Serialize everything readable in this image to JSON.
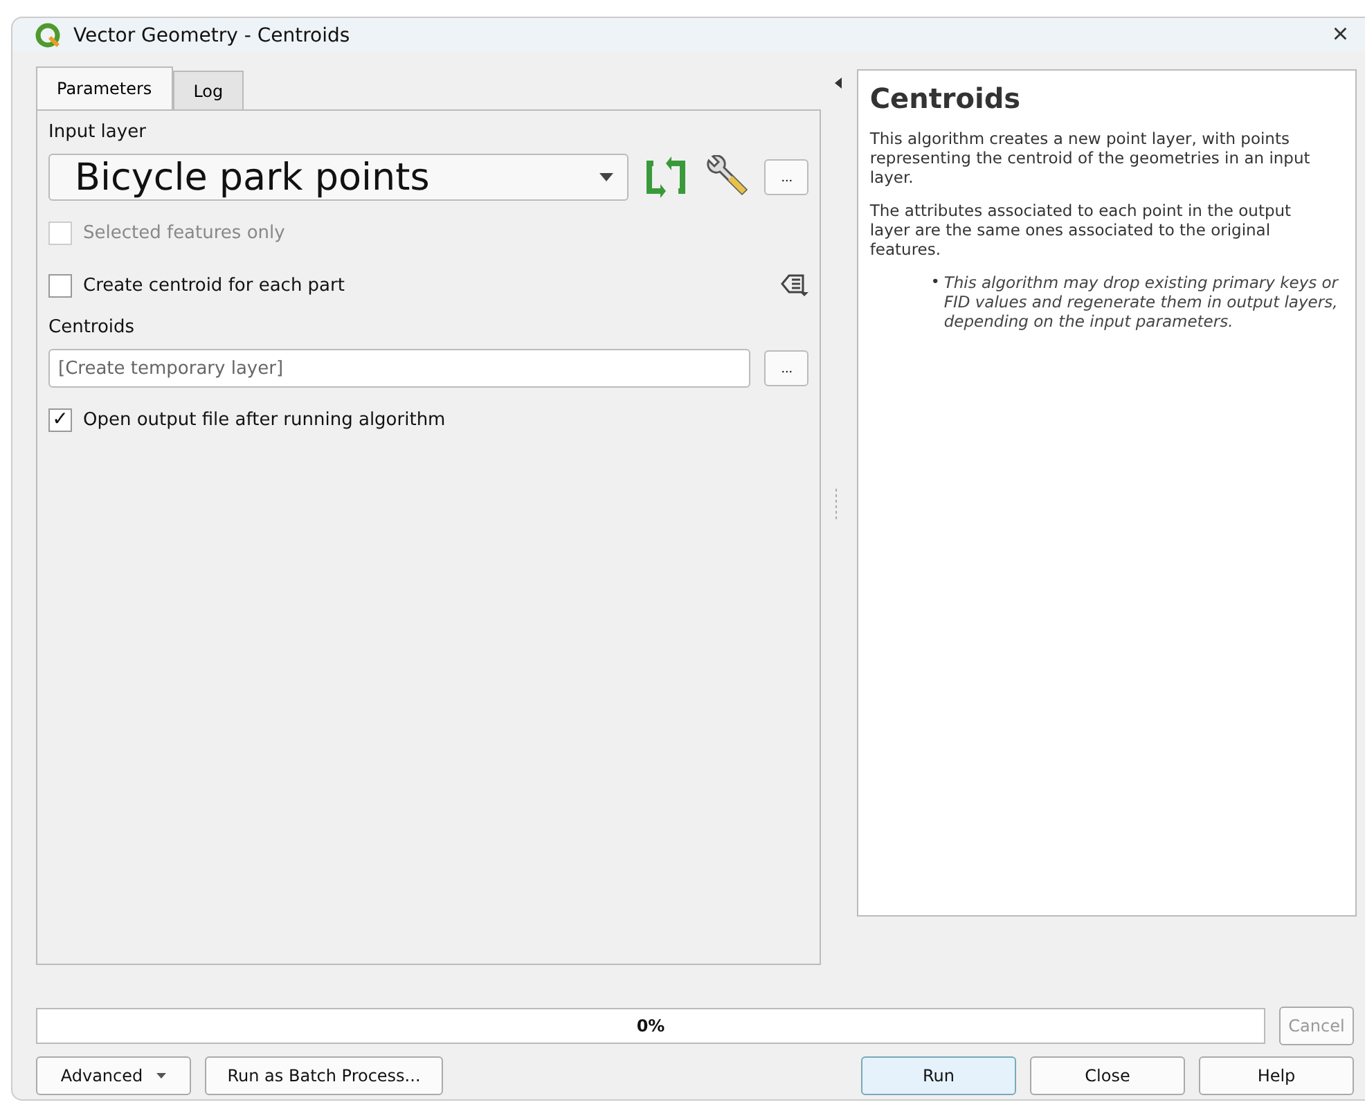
{
  "window": {
    "title": "Vector Geometry - Centroids",
    "close": "×"
  },
  "tabs": [
    {
      "label": "Parameters",
      "selected": true
    },
    {
      "label": "Log",
      "selected": false
    }
  ],
  "parameters": {
    "input_label": "Input layer",
    "input_value": "Bicycle park points",
    "options": [
      {
        "label": "Selected features only",
        "checked": false,
        "disabled": true
      },
      {
        "label": "Create centroid for each part",
        "checked": false,
        "disabled": false
      }
    ],
    "output_label": "Centroids",
    "output_placeholder": "[Create temporary layer]",
    "open_output": {
      "label": "Open output file after running algorithm",
      "checked": true,
      "mark": "✓"
    },
    "more": "..."
  },
  "help": {
    "title": "Centroids",
    "paragraphs": [
      "This algorithm creates a new point layer, with points representing the centroid of the geometries in an input layer.",
      "The attributes associated to each point in the output layer are the same ones associated to the original features."
    ],
    "bullet_mark": "•",
    "bullet": "This algorithm may drop existing primary keys or FID values and regenerate them in output layers, depending on the input parameters."
  },
  "progress": {
    "level": 0,
    "reading": "0%"
  },
  "buttons": {
    "cancel": {
      "label": "Cancel",
      "disabled": true
    },
    "advanced": "Advanced",
    "batch": "Run as Batch Process...",
    "run": "Run",
    "close": "Close",
    "help": "Help"
  }
}
